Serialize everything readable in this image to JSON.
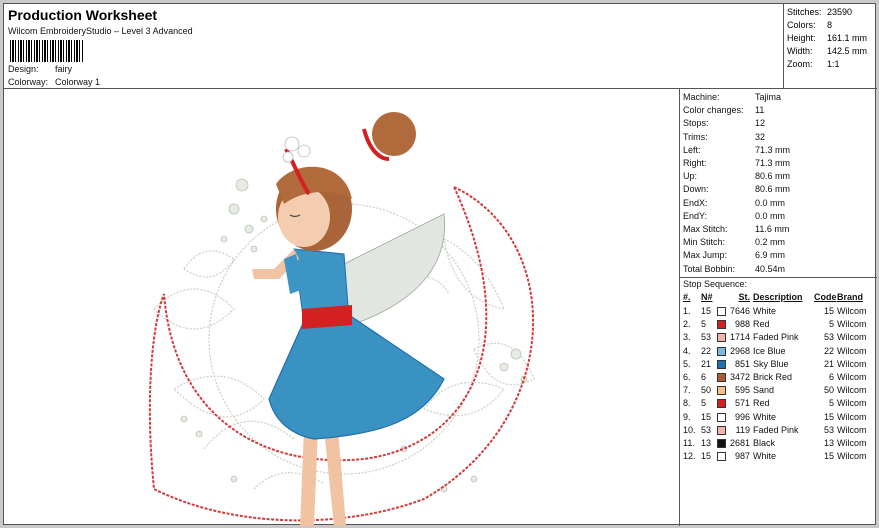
{
  "header": {
    "title": "Production Worksheet",
    "subtitle": "Wilcom EmbroideryStudio – Level 3 Advanced",
    "design_label": "Design:",
    "design_value": "fairy",
    "colorway_label": "Colorway:",
    "colorway_value": "Colorway 1"
  },
  "summary": [
    {
      "k": "Stitches:",
      "v": "23590"
    },
    {
      "k": "Colors:",
      "v": "8"
    },
    {
      "k": "Height:",
      "v": "161.1 mm"
    },
    {
      "k": "Width:",
      "v": "142.5 mm"
    },
    {
      "k": "Zoom:",
      "v": "1:1"
    }
  ],
  "machine_info": [
    {
      "k": "Machine:",
      "v": "Tajima"
    },
    {
      "k": "Color changes:",
      "v": "11"
    },
    {
      "k": "Stops:",
      "v": "12"
    },
    {
      "k": "Trims:",
      "v": "32"
    },
    {
      "k": "Left:",
      "v": "71.3 mm"
    },
    {
      "k": "Right:",
      "v": "71.3 mm"
    },
    {
      "k": "Up:",
      "v": "80.6 mm"
    },
    {
      "k": "Down:",
      "v": "80.6 mm"
    },
    {
      "k": "EndX:",
      "v": "0.0 mm"
    },
    {
      "k": "EndY:",
      "v": "0.0 mm"
    },
    {
      "k": "Max Stitch:",
      "v": "11.6 mm"
    },
    {
      "k": "Min Stitch:",
      "v": "0.2 mm"
    },
    {
      "k": "Max Jump:",
      "v": "6.9 mm"
    },
    {
      "k": "Total Bobbin:",
      "v": "40.54m"
    }
  ],
  "stop_sequence": {
    "title": "Stop Sequence:",
    "headers": {
      "num": "#.",
      "n": "N#",
      "st": "St.",
      "desc": "Description",
      "code": "Code",
      "brand": "Brand"
    },
    "rows": [
      {
        "num": "1.",
        "n": "15",
        "color": "#ffffff",
        "st": "7646",
        "desc": "White",
        "code": "15",
        "brand": "Wilcom"
      },
      {
        "num": "2.",
        "n": "5",
        "color": "#d42020",
        "st": "988",
        "desc": "Red",
        "code": "5",
        "brand": "Wilcom"
      },
      {
        "num": "3.",
        "n": "53",
        "color": "#f0b4a8",
        "st": "1714",
        "desc": "Faded Pink",
        "code": "53",
        "brand": "Wilcom"
      },
      {
        "num": "4.",
        "n": "22",
        "color": "#7ab8e0",
        "st": "2968",
        "desc": "Ice Blue",
        "code": "22",
        "brand": "Wilcom"
      },
      {
        "num": "5.",
        "n": "21",
        "color": "#1e6fb0",
        "st": "851",
        "desc": "Sky Blue",
        "code": "21",
        "brand": "Wilcom"
      },
      {
        "num": "6.",
        "n": "6",
        "color": "#b05a32",
        "st": "3472",
        "desc": "Brick Red",
        "code": "6",
        "brand": "Wilcom"
      },
      {
        "num": "7.",
        "n": "50",
        "color": "#f2c088",
        "st": "595",
        "desc": "Sand",
        "code": "50",
        "brand": "Wilcom"
      },
      {
        "num": "8.",
        "n": "5",
        "color": "#d42020",
        "st": "571",
        "desc": "Red",
        "code": "5",
        "brand": "Wilcom"
      },
      {
        "num": "9.",
        "n": "15",
        "color": "#ffffff",
        "st": "996",
        "desc": "White",
        "code": "15",
        "brand": "Wilcom"
      },
      {
        "num": "10.",
        "n": "53",
        "color": "#f0b4a8",
        "st": "119",
        "desc": "Faded Pink",
        "code": "53",
        "brand": "Wilcom"
      },
      {
        "num": "11.",
        "n": "13",
        "color": "#111111",
        "st": "2681",
        "desc": "Black",
        "code": "13",
        "brand": "Wilcom"
      },
      {
        "num": "12.",
        "n": "15",
        "color": "#ffffff",
        "st": "987",
        "desc": "White",
        "code": "15",
        "brand": "Wilcom"
      }
    ]
  }
}
